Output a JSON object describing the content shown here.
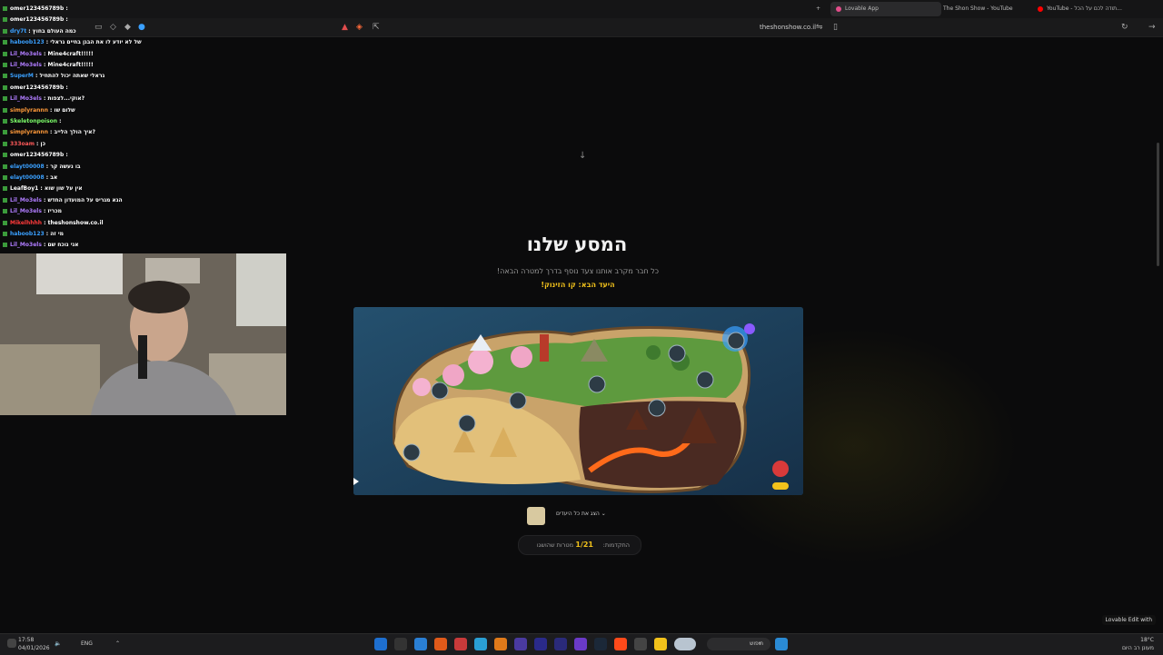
{
  "browser": {
    "tabs": [
      {
        "label": "Lovable App",
        "active": true,
        "color": "#e24d8a"
      },
      {
        "label": "The Shon Show - YouTube",
        "active": false,
        "color": "#ff0000"
      },
      {
        "label": "YouTube - תודה לכם על הכל...",
        "active": false,
        "color": "#ff0000"
      }
    ],
    "url": "theshonshow.co.il"
  },
  "page": {
    "title": "המסע שלנו",
    "subtitle": "כל חבר מקרב אותנו צעד נוסף בדרך למטרה הבאה!",
    "next_destination": "היעד הבא: קו הזינוק!",
    "show_all_label": "הצג את כל היעדים",
    "progress_label": "התקדמות:",
    "progress_value": "1/21",
    "progress_suffix": "מטרות שהושגו",
    "edit_badge": "Lovable  Edit with",
    "accent_color": "#f2c21b"
  },
  "chat": [
    {
      "user": "omer123456789b",
      "msg": "",
      "color": "#ffffff"
    },
    {
      "user": "omer123456789b",
      "msg": "",
      "color": "#ffffff"
    },
    {
      "user": "dry7t",
      "msg": "כמה העולם בחוץ",
      "color": "#3aa0ff"
    },
    {
      "user": "haboob123",
      "msg": "של לא יודע לו את הבגן בחיים גראלי",
      "color": "#3aa0ff"
    },
    {
      "user": "Lil_Mo3els",
      "msg": "Mine4craft!!!!!",
      "color": "#b07cff"
    },
    {
      "user": "Lil_Mo3els",
      "msg": "Mine4craft!!!!!",
      "color": "#b07cff"
    },
    {
      "user": "SuperM",
      "msg": "גראלי שאתה יכול להתחיל",
      "color": "#3aa0ff"
    },
    {
      "user": "omer123456789b",
      "msg": "",
      "color": "#ffffff"
    },
    {
      "user": "Lil_Mo3els",
      "msg": "אוקי...לצפות?",
      "color": "#b07cff"
    },
    {
      "user": "simplyrannn",
      "msg": "שלום שו",
      "color": "#ff9a3a"
    },
    {
      "user": "Skeletonpoison",
      "msg": "",
      "color": "#7dff6a"
    },
    {
      "user": "simplyrannn",
      "msg": "איך הולך הלייב?",
      "color": "#ff9a3a"
    },
    {
      "user": "333oam",
      "msg": "כן",
      "color": "#ff5a5a"
    },
    {
      "user": "omer123456789b",
      "msg": "",
      "color": "#ffffff"
    },
    {
      "user": "elayt00008",
      "msg": "בו נעשה קר",
      "color": "#3aa0ff"
    },
    {
      "user": "elayt00008",
      "msg": "אב",
      "color": "#3aa0ff"
    },
    {
      "user": "LeafBoy1",
      "msg": "אין על שון שוא",
      "color": "#ffffff"
    },
    {
      "user": "Lil_Mo3els",
      "msg": "הגא מגריס על המועדון החדש",
      "color": "#b07cff"
    },
    {
      "user": "Lil_Mo3els",
      "msg": "מכריז",
      "color": "#b07cff"
    },
    {
      "user": "Mikelhhhh",
      "msg": "theshonshow.co.il",
      "color": "#ff3a3a"
    },
    {
      "user": "haboob123",
      "msg": "מי זה",
      "color": "#3aa0ff"
    },
    {
      "user": "Lil_Mo3els",
      "msg": "אני נוכח שם",
      "color": "#b07cff"
    }
  ],
  "taskbar": {
    "time": "17:58",
    "date": "04/01/2026",
    "lang": "ENG",
    "search_label": "חיפוש",
    "weather_temp": "18°C",
    "weather_desc": "מעונן רב היום"
  }
}
